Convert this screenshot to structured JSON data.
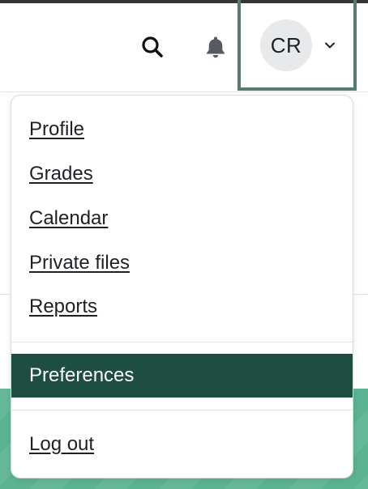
{
  "navbar": {
    "search_icon": "search-icon",
    "notification_icon": "bell-icon"
  },
  "user_menu": {
    "initials": "CR",
    "caret_icon": "chevron-down-icon",
    "items": [
      {
        "label": "Profile"
      },
      {
        "label": "Grades"
      },
      {
        "label": "Calendar"
      },
      {
        "label": "Private files"
      },
      {
        "label": "Reports"
      },
      {
        "label": "Preferences",
        "active": true
      },
      {
        "label": "Log out"
      }
    ]
  },
  "colors": {
    "active_item_bg": "#1e4d42",
    "focus_border": "#587a73",
    "page_accent": "#5ab392"
  }
}
